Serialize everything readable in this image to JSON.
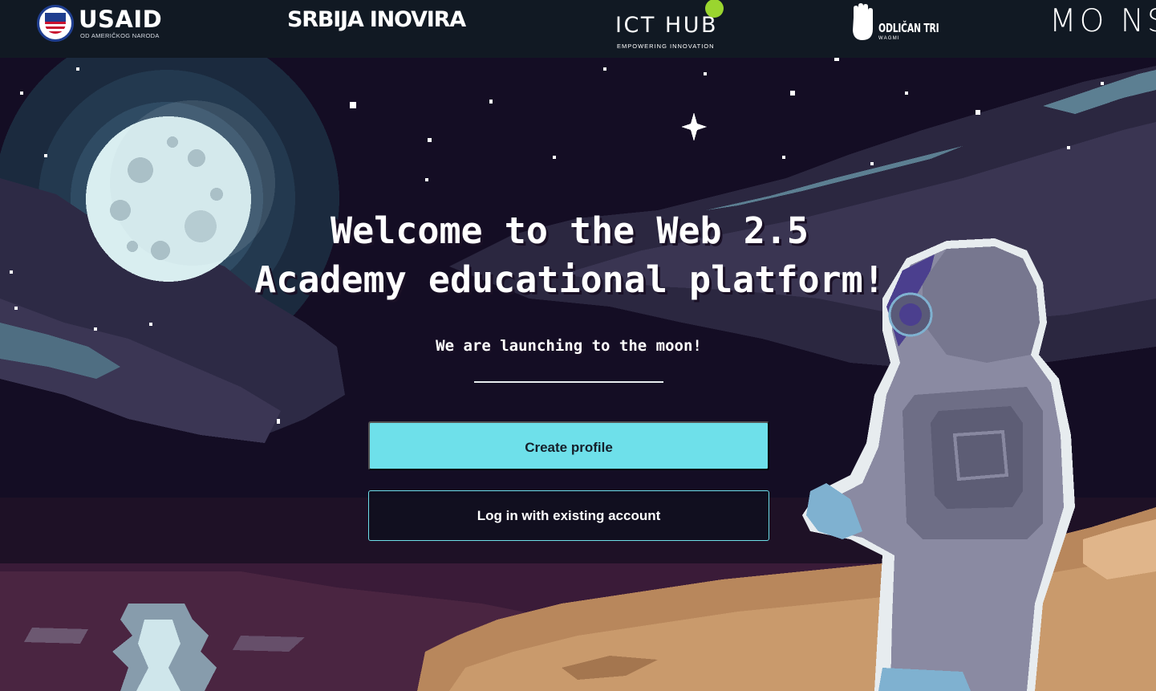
{
  "partners": {
    "usaid": {
      "name": "USAID",
      "tagline": "OD AMERIČKOG NARODA"
    },
    "srbija": {
      "name": "SRBIJA INOVIRA"
    },
    "ict_hub": {
      "name": "ICT HUB",
      "tagline": "EMPOWERING INNOVATION"
    },
    "odlican": {
      "name": "ODLIČAN TRI",
      "tagline": "WAGMI"
    },
    "moonstation": {
      "name": "MO NST"
    }
  },
  "hero": {
    "title_line1": "Welcome to the Web 2.5",
    "title_line2": "Academy educational platform!",
    "subtitle": "We are launching to the moon!",
    "create_profile_label": "Create profile",
    "login_label": "Log in with existing account"
  },
  "colors": {
    "accent": "#6ee0ea",
    "header_bg": "#111923",
    "sky": "#140d24",
    "ict_dot": "#9ad52f"
  }
}
